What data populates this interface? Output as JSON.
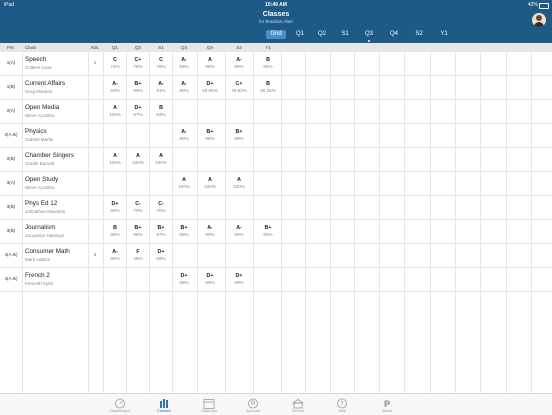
{
  "status_bar": {
    "device": "iPad",
    "time": "10:49 AM",
    "battery": "42%"
  },
  "nav": {
    "title": "Classes",
    "subtitle": "for Brandon Aber"
  },
  "segments": [
    {
      "label": "Grid",
      "active": true,
      "dot": false
    },
    {
      "label": "Q1",
      "active": false,
      "dot": false
    },
    {
      "label": "Q2",
      "active": false,
      "dot": false
    },
    {
      "label": "S1",
      "active": false,
      "dot": false
    },
    {
      "label": "Q3",
      "active": false,
      "dot": true
    },
    {
      "label": "Q4",
      "active": false,
      "dot": false
    },
    {
      "label": "S2",
      "active": false,
      "dot": false
    },
    {
      "label": "Y1",
      "active": false,
      "dot": false
    }
  ],
  "table": {
    "headers": {
      "per": "Per.",
      "class": "Class",
      "abs": "Abs.",
      "q1": "Q1",
      "q2": "Q2",
      "s1": "S1",
      "q3": "Q3",
      "q4": "Q4",
      "s2": "S2",
      "y1": "Y1"
    },
    "rows": [
      {
        "per": "1(A)",
        "name": "Speech",
        "teacher": "Colleen Luna",
        "abs": "1",
        "q1": {
          "g": "C",
          "p": "74%"
        },
        "q2": {
          "g": "C+",
          "p": "78%"
        },
        "s1": {
          "g": "C",
          "p": "76%"
        },
        "q3": {
          "g": "A-",
          "p": "93%"
        },
        "q4": {
          "g": "A",
          "p": "96%"
        },
        "s2": {
          "g": "A-",
          "p": "95%"
        },
        "y1": {
          "g": "B",
          "p": "86%"
        }
      },
      {
        "per": "1(B)",
        "name": "Current Affairs",
        "teacher": "Greg Marston",
        "abs": "",
        "q1": {
          "g": "A-",
          "p": "93%"
        },
        "q2": {
          "g": "B+",
          "p": "89%"
        },
        "s1": {
          "g": "A-",
          "p": "91%"
        },
        "q3": {
          "g": "A-",
          "p": "90%"
        },
        "q4": {
          "g": "D+",
          "p": "69.66%"
        },
        "s2": {
          "g": "C+",
          "p": "79.83%"
        },
        "y1": {
          "g": "B",
          "p": "85.55%"
        }
      },
      {
        "per": "2(A)",
        "name": "Open Media",
        "teacher": "Steve Accalino",
        "abs": "",
        "q1": {
          "g": "A",
          "p": "100%"
        },
        "q2": {
          "g": "D+",
          "p": "67%"
        },
        "s1": {
          "g": "B",
          "p": "83%"
        },
        "q3": {
          "g": "",
          "p": ""
        },
        "q4": {
          "g": "",
          "p": ""
        },
        "s2": {
          "g": "",
          "p": ""
        },
        "y1": {
          "g": "",
          "p": ""
        }
      },
      {
        "per": "2(A-B)",
        "name": "Physics",
        "teacher": "Gabriel Martin",
        "abs": "",
        "q1": {
          "g": "",
          "p": ""
        },
        "q2": {
          "g": "",
          "p": ""
        },
        "s1": {
          "g": "",
          "p": ""
        },
        "q3": {
          "g": "A-",
          "p": "90%"
        },
        "q4": {
          "g": "B+",
          "p": "88%"
        },
        "s2": {
          "g": "B+",
          "p": "89%"
        },
        "y1": {
          "g": "",
          "p": ""
        }
      },
      {
        "per": "2(B)",
        "name": "Chamber Singers",
        "teacher": "Gordie Barnett",
        "abs": "",
        "q1": {
          "g": "A",
          "p": "100%"
        },
        "q2": {
          "g": "A",
          "p": "100%"
        },
        "s1": {
          "g": "A",
          "p": "100%"
        },
        "q3": {
          "g": "",
          "p": ""
        },
        "q4": {
          "g": "",
          "p": ""
        },
        "s2": {
          "g": "",
          "p": ""
        },
        "y1": {
          "g": "",
          "p": ""
        }
      },
      {
        "per": "3(A)",
        "name": "Open Study",
        "teacher": "Steve Accalino",
        "abs": "",
        "q1": {
          "g": "",
          "p": ""
        },
        "q2": {
          "g": "",
          "p": ""
        },
        "s1": {
          "g": "",
          "p": ""
        },
        "q3": {
          "g": "A",
          "p": "100%"
        },
        "q4": {
          "g": "A",
          "p": "100%"
        },
        "s2": {
          "g": "A",
          "p": "100%"
        },
        "y1": {
          "g": "",
          "p": ""
        }
      },
      {
        "per": "3(B)",
        "name": "Phys Ed 12",
        "teacher": "Johnathan Mawston",
        "abs": "",
        "q1": {
          "g": "D+",
          "p": "69%"
        },
        "q2": {
          "g": "C-",
          "p": "70%"
        },
        "s1": {
          "g": "C-",
          "p": "70%"
        },
        "q3": {
          "g": "",
          "p": ""
        },
        "q4": {
          "g": "",
          "p": ""
        },
        "s2": {
          "g": "",
          "p": ""
        },
        "y1": {
          "g": "",
          "p": ""
        }
      },
      {
        "per": "3(B)",
        "name": "Journalism",
        "teacher": "Jacquelyn Hastings",
        "abs": "",
        "q1": {
          "g": "B",
          "p": "86%"
        },
        "q2": {
          "g": "B+",
          "p": "88%"
        },
        "s1": {
          "g": "B+",
          "p": "87%"
        },
        "q3": {
          "g": "B+",
          "p": "89%"
        },
        "q4": {
          "g": "A-",
          "p": "90%"
        },
        "s2": {
          "g": "A-",
          "p": "90%"
        },
        "y1": {
          "g": "B+",
          "p": "89%"
        }
      },
      {
        "per": "4(A-B)",
        "name": "Consumer Math",
        "teacher": "Mark Adams",
        "abs": "3",
        "q1": {
          "g": "A-",
          "p": "90%"
        },
        "q2": {
          "g": "F",
          "p": "45%"
        },
        "s1": {
          "g": "D+",
          "p": "68%"
        },
        "q3": {
          "g": "",
          "p": ""
        },
        "q4": {
          "g": "",
          "p": ""
        },
        "s2": {
          "g": "",
          "p": ""
        },
        "y1": {
          "g": "",
          "p": ""
        }
      },
      {
        "per": "4(A-B)",
        "name": "French 2",
        "teacher": "Kenneth Kytel",
        "abs": "",
        "q1": {
          "g": "",
          "p": ""
        },
        "q2": {
          "g": "",
          "p": ""
        },
        "s1": {
          "g": "",
          "p": ""
        },
        "q3": {
          "g": "D+",
          "p": "68%"
        },
        "q4": {
          "g": "D+",
          "p": "69%"
        },
        "s2": {
          "g": "D+",
          "p": "69%"
        },
        "y1": {
          "g": "",
          "p": ""
        }
      }
    ]
  },
  "tabs": [
    {
      "label": "Dashboard",
      "icon": "dashboard-icon",
      "active": false
    },
    {
      "label": "Classes",
      "icon": "classes-icon",
      "active": true
    },
    {
      "label": "Calendar",
      "icon": "calendar-icon",
      "active": false
    },
    {
      "label": "Account",
      "icon": "account-icon",
      "active": false
    },
    {
      "label": "School",
      "icon": "school-icon",
      "active": false
    },
    {
      "label": "Help",
      "icon": "help-icon",
      "active": false
    },
    {
      "label": "About",
      "icon": "about-icon",
      "active": false
    }
  ],
  "colors": {
    "nav_bg": "#1e5a86",
    "active_seg": "#4a90c8",
    "tab_active": "#2f77b5"
  }
}
